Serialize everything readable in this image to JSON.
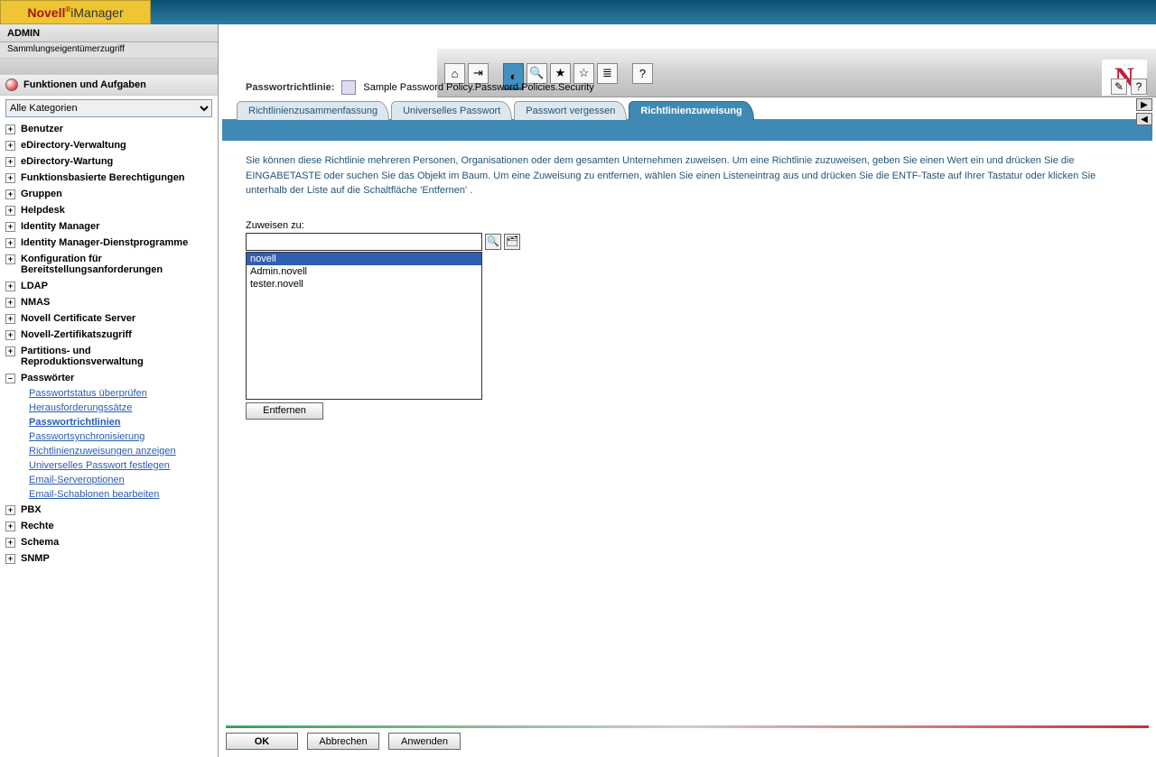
{
  "brand": {
    "novell": "Novell",
    "imanager": " iManager"
  },
  "admin_label": "ADMIN",
  "sammlung": "Sammlungseigentümerzugriff",
  "toolbar": {
    "home": "⌂",
    "exit": "⇥",
    "view": "◐",
    "search": "🔍",
    "fav": "★",
    "star": "☆",
    "list": "≣",
    "help": "?"
  },
  "big_n": "N",
  "sidebar": {
    "title": "Funktionen und Aufgaben",
    "dropdown": "Alle Kategorien",
    "items": [
      {
        "label": "Benutzer",
        "expand": "+"
      },
      {
        "label": "eDirectory-Verwaltung",
        "expand": "+"
      },
      {
        "label": "eDirectory-Wartung",
        "expand": "+"
      },
      {
        "label": "Funktionsbasierte Berechtigungen",
        "expand": "+"
      },
      {
        "label": "Gruppen",
        "expand": "+"
      },
      {
        "label": "Helpdesk",
        "expand": "+"
      },
      {
        "label": "Identity Manager",
        "expand": "+"
      },
      {
        "label": "Identity Manager-Dienstprogramme",
        "expand": "+"
      },
      {
        "label": "Konfiguration für Bereitstellungsanforderungen",
        "expand": "+"
      },
      {
        "label": "LDAP",
        "expand": "+"
      },
      {
        "label": "NMAS",
        "expand": "+"
      },
      {
        "label": "Novell Certificate Server",
        "expand": "+"
      },
      {
        "label": "Novell-Zertifikatszugriff",
        "expand": "+"
      },
      {
        "label": "Partitions- und Reproduktionsverwaltung",
        "expand": "+"
      },
      {
        "label": "Passwörter",
        "expand": "–",
        "sub": [
          {
            "label": "Passwortstatus überprüfen"
          },
          {
            "label": "Herausforderungssätze"
          },
          {
            "label": "Passwortrichtlinien",
            "active": true
          },
          {
            "label": "Passwortsynchronisierung"
          },
          {
            "label": "Richtlinienzuweisungen anzeigen"
          },
          {
            "label": "Universelles Passwort festlegen"
          },
          {
            "label": "Email-Serveroptionen"
          },
          {
            "label": "Email-Schablonen bearbeiten"
          }
        ]
      },
      {
        "label": "PBX",
        "expand": "+"
      },
      {
        "label": "Rechte",
        "expand": "+"
      },
      {
        "label": "Schema",
        "expand": "+"
      },
      {
        "label": "SNMP",
        "expand": "+"
      }
    ]
  },
  "page": {
    "title": "Passwortrichtlinie:",
    "path": "Sample Password Policy.Password Policies.Security",
    "edit_icon": "✎",
    "help_icon": "?",
    "arrow_right": "▶",
    "arrow_left": "◀"
  },
  "tabs": [
    {
      "label": "Richtlinienzusammenfassung"
    },
    {
      "label": "Universelles Passwort"
    },
    {
      "label": "Passwort vergessen"
    },
    {
      "label": "Richtlinienzuweisung",
      "active": true
    }
  ],
  "body_text": "Sie können diese Richtlinie mehreren Personen, Organisationen oder dem gesamten Unternehmen zuweisen. Um eine Richtlinie zuzuweisen, geben Sie einen Wert ein und drücken Sie die EINGABETASTE oder suchen Sie das Objekt im Baum. Um eine Zuweisung zu entfernen, wählen Sie einen Listeneintrag aus und drücken Sie die ENTF-Taste auf Ihrer Tastatur oder klicken Sie unterhalb der Liste auf die Schaltfläche 'Entfernen' .",
  "assign": {
    "label": "Zuweisen zu:",
    "input_value": "",
    "search_icon": "🔍",
    "tree_icon": "🗂",
    "list": [
      {
        "label": "novell",
        "selected": true
      },
      {
        "label": "Admin.novell"
      },
      {
        "label": "tester.novell"
      }
    ],
    "remove": "Entfernen"
  },
  "actions": {
    "ok": "OK",
    "cancel": "Abbrechen",
    "apply": "Anwenden"
  }
}
